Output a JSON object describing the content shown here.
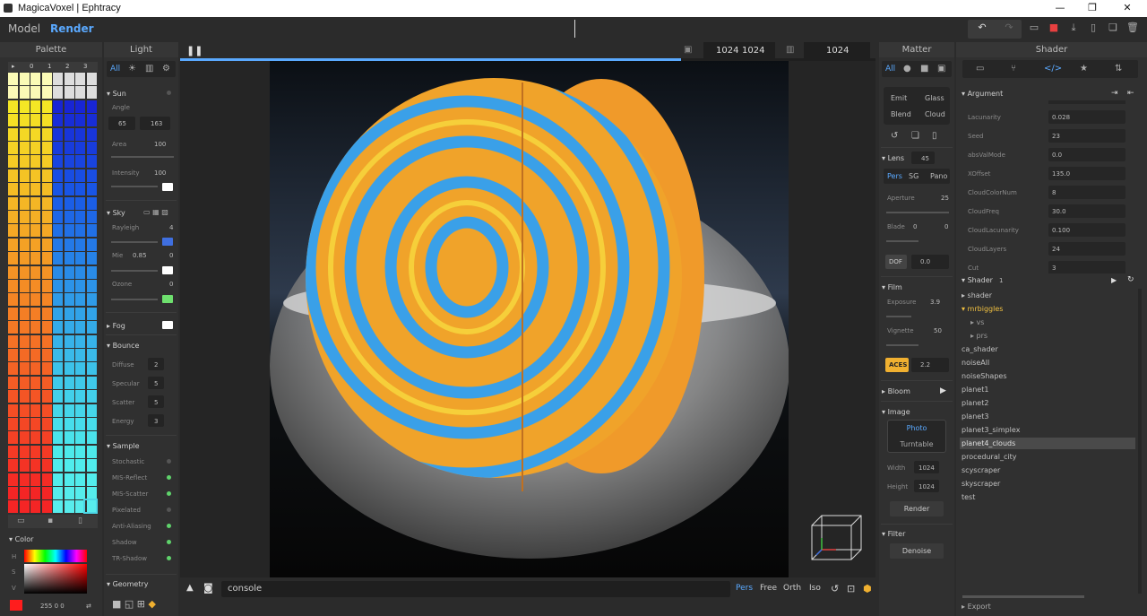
{
  "window": {
    "title": "MagicaVoxel | Ephtracy"
  },
  "menu": {
    "model": "Model",
    "render": "Render"
  },
  "palette": {
    "title": "Palette",
    "tabs": [
      "▸",
      "0",
      "1",
      "2",
      "3"
    ],
    "selected_color": "#ff1d1d"
  },
  "color_section": {
    "title": "Color",
    "h": "H",
    "s": "S",
    "v": "V",
    "rgb": "255 0 0"
  },
  "light": {
    "title": "Light",
    "tabs": {
      "all": "All"
    },
    "sun": {
      "title": "Sun",
      "angle_label": "Angle",
      "angle_a": "65",
      "angle_b": "163",
      "area_label": "Area",
      "area": "100",
      "intensity_label": "Intensity",
      "intensity": "100"
    },
    "sky": {
      "title": "Sky",
      "rayleigh_label": "Rayleigh",
      "rayleigh": "4",
      "mie_label": "Mie",
      "mie_a": "0.85",
      "mie_b": "0",
      "ozone_label": "Ozone",
      "ozone": "0",
      "rayleigh_color": "#3f6fe0",
      "ozone_color": "#6ee06e"
    },
    "fog": {
      "title": "Fog"
    },
    "bounce": {
      "title": "Bounce",
      "diffuse_label": "Diffuse",
      "diffuse": "2",
      "specular_label": "Specular",
      "specular": "5",
      "scatter_label": "Scatter",
      "scatter": "5",
      "energy_label": "Energy",
      "energy": "3"
    },
    "sample": {
      "title": "Sample",
      "items": [
        {
          "label": "Stochastic",
          "on": false
        },
        {
          "label": "MIS-Reflect",
          "on": true
        },
        {
          "label": "MIS-Scatter",
          "on": true
        },
        {
          "label": "Pixelated",
          "on": false
        },
        {
          "label": "Anti-Aliasing",
          "on": true
        },
        {
          "label": "Shadow",
          "on": true
        },
        {
          "label": "TR-Shadow",
          "on": true
        }
      ]
    },
    "geometry": {
      "title": "Geometry"
    }
  },
  "viewport": {
    "width": "1024",
    "height": "1024",
    "sample_count": "1024",
    "progress": 0.72,
    "console": "console",
    "views": [
      "Pers",
      "Free",
      "Orth",
      "Iso"
    ]
  },
  "matter": {
    "title": "Matter",
    "tabs": {
      "all": "All"
    },
    "types": [
      "Emit",
      "Glass",
      "Blend",
      "Cloud"
    ],
    "lens": {
      "title": "Lens",
      "fov": "45",
      "modes": [
        "Pers",
        "SG",
        "Pano"
      ],
      "aperture_label": "Aperture",
      "aperture": "25",
      "blade_label": "Blade",
      "blade_a": "0",
      "blade_b": "0",
      "dof_label": "DOF",
      "dof": "0.0"
    },
    "film": {
      "title": "Film",
      "exposure_label": "Exposure",
      "exposure": "3.9",
      "vignette_label": "Vignette",
      "vignette": "50",
      "aces_label": "ACES",
      "aces": "2.2"
    },
    "bloom": {
      "title": "Bloom"
    },
    "image": {
      "title": "Image",
      "photo": "Photo",
      "turntable": "Turntable",
      "width_label": "Width",
      "width": "1024",
      "height_label": "Height",
      "height": "1024",
      "render": "Render"
    },
    "filter": {
      "title": "Filter",
      "denoise": "Denoise"
    }
  },
  "shader": {
    "title": "Shader",
    "argument_title": "Argument",
    "args": [
      {
        "label": "Lacunarity",
        "value": "0.028"
      },
      {
        "label": "Seed",
        "value": "23"
      },
      {
        "label": "absValMode",
        "value": "0.0"
      },
      {
        "label": "XOffset",
        "value": "135.0"
      },
      {
        "label": "CloudColorNum",
        "value": "8"
      },
      {
        "label": "CloudFreq",
        "value": "30.0"
      },
      {
        "label": "CloudLacunarity",
        "value": "0.100"
      },
      {
        "label": "CloudLayers",
        "value": "24"
      },
      {
        "label": "Cut",
        "value": "3"
      }
    ],
    "shader_list_title": "Shader",
    "shader_list_count": "1",
    "tree": [
      {
        "label": "▸ shader",
        "indent": 0,
        "color": "#c0c0c0",
        "selected": false
      },
      {
        "label": "▾ mrbiggles",
        "indent": 0,
        "color": "#f0c040",
        "selected": false
      },
      {
        "label": "▸ vs",
        "indent": 1,
        "color": "#999",
        "selected": false
      },
      {
        "label": "▸ prs",
        "indent": 1,
        "color": "#999",
        "selected": false
      },
      {
        "label": "ca_shader",
        "indent": 0,
        "color": "#c0c0c0",
        "selected": false
      },
      {
        "label": "noiseAll",
        "indent": 0,
        "color": "#c0c0c0",
        "selected": false
      },
      {
        "label": "noiseShapes",
        "indent": 0,
        "color": "#c0c0c0",
        "selected": false
      },
      {
        "label": "planet1",
        "indent": 0,
        "color": "#c0c0c0",
        "selected": false
      },
      {
        "label": "planet2",
        "indent": 0,
        "color": "#c0c0c0",
        "selected": false
      },
      {
        "label": "planet3",
        "indent": 0,
        "color": "#c0c0c0",
        "selected": false
      },
      {
        "label": "planet3_simplex",
        "indent": 0,
        "color": "#c0c0c0",
        "selected": false
      },
      {
        "label": "planet4_clouds",
        "indent": 0,
        "color": "#e0e0e0",
        "selected": true
      },
      {
        "label": "procedural_city",
        "indent": 0,
        "color": "#c0c0c0",
        "selected": false
      },
      {
        "label": "scyscraper",
        "indent": 0,
        "color": "#c0c0c0",
        "selected": false
      },
      {
        "label": "skyscraper",
        "indent": 0,
        "color": "#c0c0c0",
        "selected": false
      },
      {
        "label": "test",
        "indent": 0,
        "color": "#c0c0c0",
        "selected": false
      }
    ],
    "export": "Export"
  }
}
